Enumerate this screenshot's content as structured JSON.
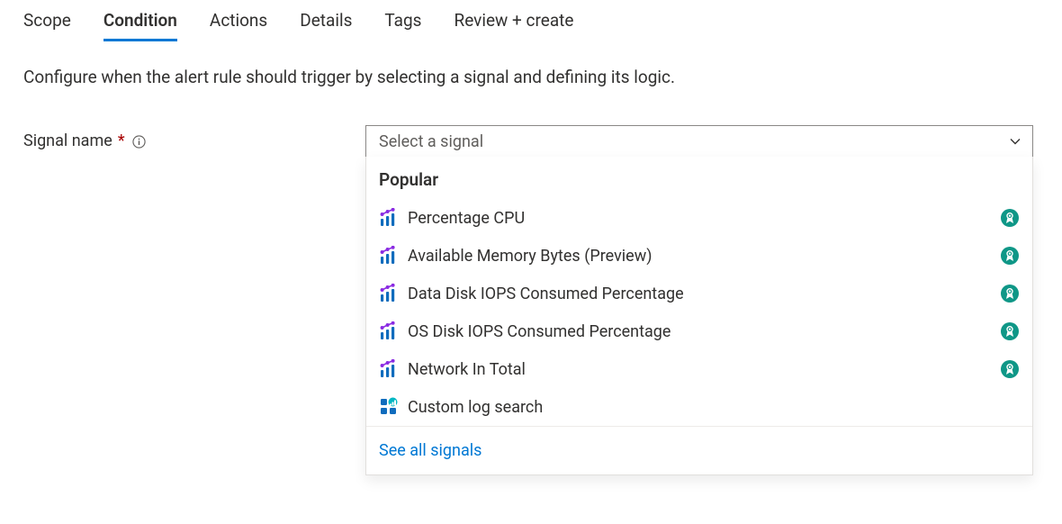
{
  "tabs": [
    {
      "label": "Scope"
    },
    {
      "label": "Condition"
    },
    {
      "label": "Actions"
    },
    {
      "label": "Details"
    },
    {
      "label": "Tags"
    },
    {
      "label": "Review + create"
    }
  ],
  "active_tab_index": 1,
  "description": "Configure when the alert rule should trigger by selecting a signal and defining its logic.",
  "form": {
    "signal_name_label": "Signal name",
    "required_mark": "*"
  },
  "dropdown": {
    "placeholder": "Select a signal",
    "group_title": "Popular",
    "see_all_label": "See all signals",
    "items": [
      {
        "label": "Percentage CPU",
        "icon": "metric",
        "recommended": true
      },
      {
        "label": "Available Memory Bytes (Preview)",
        "icon": "metric",
        "recommended": true
      },
      {
        "label": "Data Disk IOPS Consumed Percentage",
        "icon": "metric",
        "recommended": true
      },
      {
        "label": "OS Disk IOPS Consumed Percentage",
        "icon": "metric",
        "recommended": true
      },
      {
        "label": "Network In Total",
        "icon": "metric",
        "recommended": true
      },
      {
        "label": "Custom log search",
        "icon": "log",
        "recommended": false
      }
    ]
  }
}
